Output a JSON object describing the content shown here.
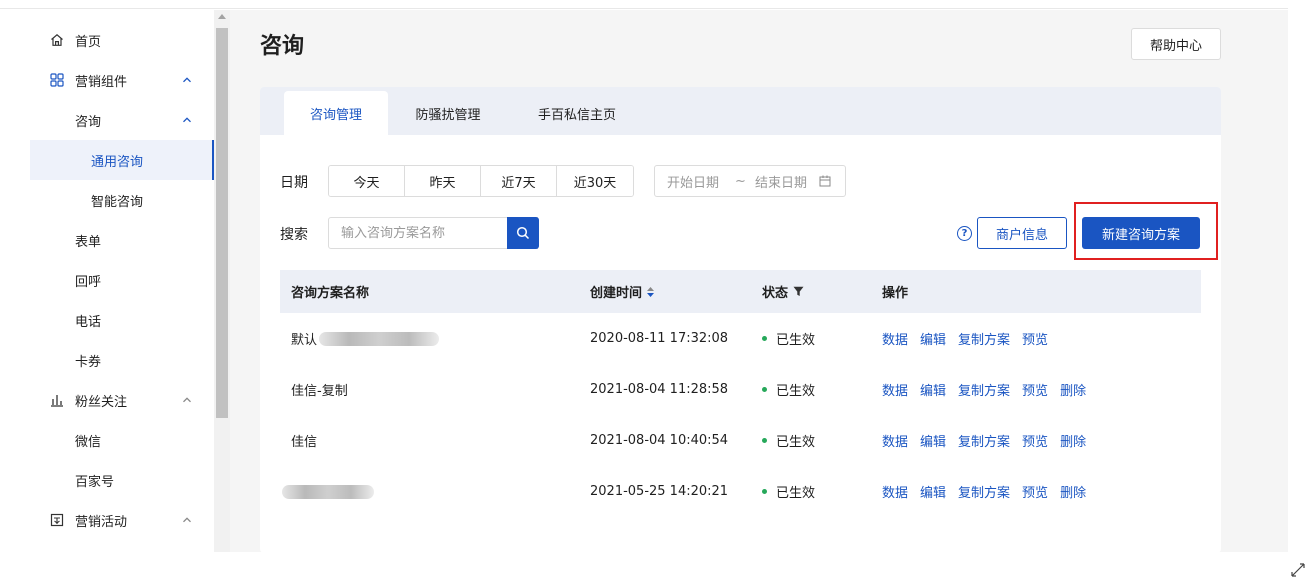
{
  "sidebar": {
    "items": [
      {
        "label": "首页",
        "icon": "home-icon"
      },
      {
        "label": "营销组件",
        "icon": "grid-icon",
        "chevron": "up"
      },
      {
        "label": "咨询",
        "chevron": "up"
      },
      {
        "label": "通用咨询",
        "active": true
      },
      {
        "label": "智能咨询"
      },
      {
        "label": "表单"
      },
      {
        "label": "回呼"
      },
      {
        "label": "电话"
      },
      {
        "label": "卡券"
      },
      {
        "label": "粉丝关注",
        "icon": "bar-chart-icon",
        "chevron": "up"
      },
      {
        "label": "微信"
      },
      {
        "label": "百家号"
      },
      {
        "label": "营销活动",
        "icon": "gift-icon",
        "chevron": "up"
      }
    ]
  },
  "header": {
    "title": "咨询",
    "help_label": "帮助中心"
  },
  "tabs": [
    {
      "label": "咨询管理",
      "active": true
    },
    {
      "label": "防骚扰管理"
    },
    {
      "label": "手百私信主页"
    }
  ],
  "filters": {
    "date_label": "日期",
    "date_options": [
      "今天",
      "昨天",
      "近7天",
      "近30天"
    ],
    "date_start_placeholder": "开始日期",
    "date_separator": "~",
    "date_end_placeholder": "结束日期",
    "search_label": "搜索",
    "search_placeholder": "输入咨询方案名称"
  },
  "actions": {
    "merchant_label": "商户信息",
    "new_label": "新建咨询方案",
    "help_icon": "?"
  },
  "table": {
    "columns": [
      "咨询方案名称",
      "创建时间",
      "状态",
      "操作"
    ],
    "rows": [
      {
        "name": "默认",
        "created": "2020-08-11 17:32:08",
        "status": "已生效",
        "actions": [
          "数据",
          "编辑",
          "复制方案",
          "预览"
        ]
      },
      {
        "name": "佳信-复制",
        "created": "2021-08-04 11:28:58",
        "status": "已生效",
        "actions": [
          "数据",
          "编辑",
          "复制方案",
          "预览",
          "删除"
        ]
      },
      {
        "name": "佳信",
        "created": "2021-08-04 10:40:54",
        "status": "已生效",
        "actions": [
          "数据",
          "编辑",
          "复制方案",
          "预览",
          "删除"
        ]
      },
      {
        "name": "",
        "created": "2021-05-25 14:20:21",
        "status": "已生效",
        "actions": [
          "数据",
          "编辑",
          "复制方案",
          "预览",
          "删除"
        ]
      }
    ]
  },
  "colors": {
    "accent": "#1a55c2",
    "status_ok": "#26a85a",
    "highlight": "#e02020"
  }
}
